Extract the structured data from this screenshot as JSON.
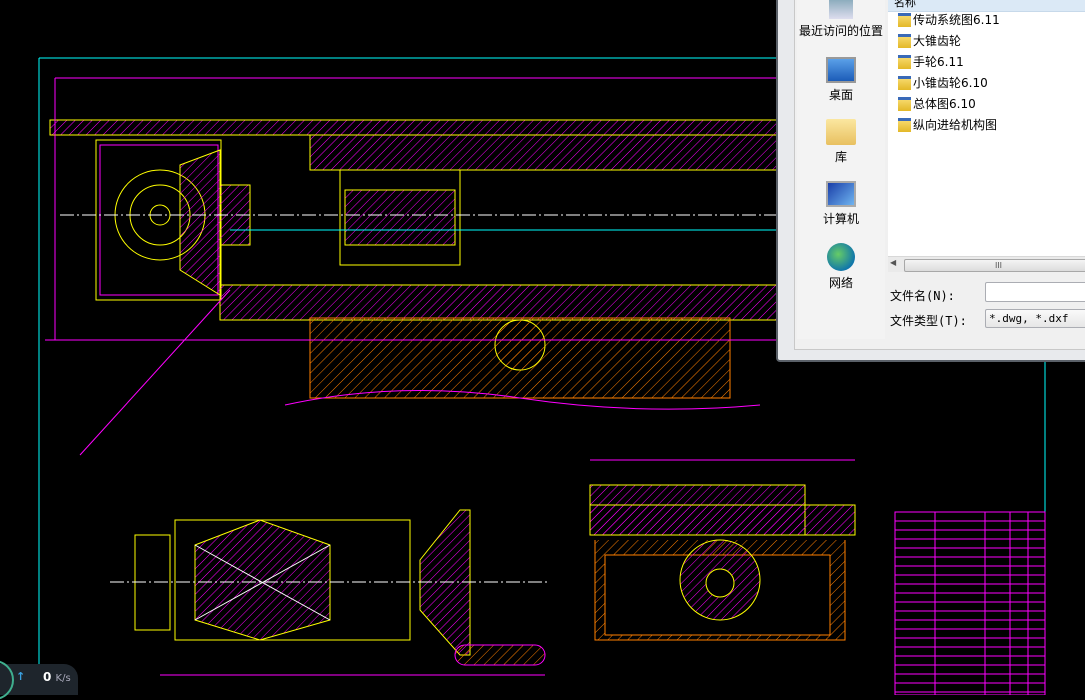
{
  "cad": {
    "colors": {
      "background": "#000000",
      "frame": "#00ffff",
      "outline": "#ffff00",
      "hatch": "#ff00ff",
      "base_hatch": "#ff7f00",
      "dimension": "#ff00ff",
      "centerline": "#ffffff"
    }
  },
  "dialog": {
    "list_header": "名称",
    "places": [
      {
        "label": "最近访问的位置",
        "icon": "recent-places-icon"
      },
      {
        "label": "桌面",
        "icon": "desktop-icon"
      },
      {
        "label": "库",
        "icon": "libraries-icon"
      },
      {
        "label": "计算机",
        "icon": "computer-icon"
      },
      {
        "label": "网络",
        "icon": "network-icon"
      }
    ],
    "files": [
      "传动系统图6.11",
      "大锥齿轮",
      "手轮6.11",
      "小锥齿轮6.10",
      "总体图6.10",
      "纵向进给机构图"
    ],
    "scrollbar_grip": "III",
    "filename_label": "文件名(N):",
    "filename_value": "",
    "filetype_label": "文件类型(T):",
    "filetype_value": "*.dwg, *.dxf"
  },
  "net_widget": {
    "arrow": "↑",
    "value": "0",
    "unit": "K/s"
  }
}
